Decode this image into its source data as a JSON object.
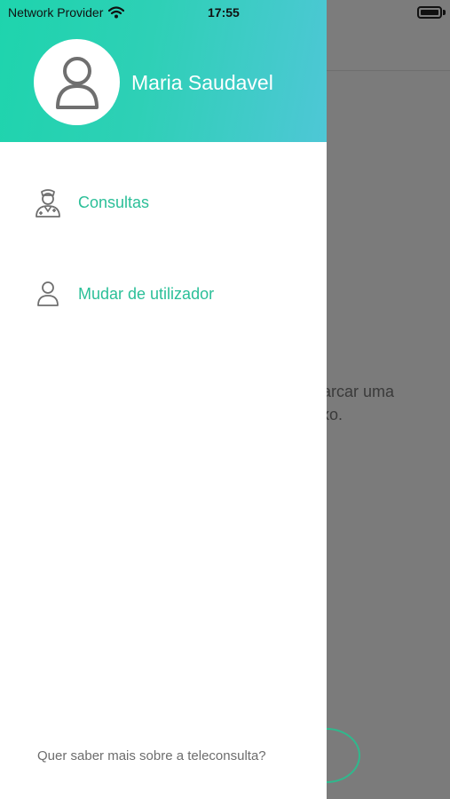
{
  "status_bar": {
    "carrier": "Network Provider",
    "time": "17:55",
    "icons": [
      "wifi-icon",
      "battery-icon"
    ]
  },
  "drawer": {
    "user_name": "Maria Saudavel",
    "avatar_icon": "user-icon",
    "items": [
      {
        "label": "Consultas",
        "icon": "doctor-icon"
      },
      {
        "label": "Mudar de utilizador",
        "icon": "user-icon"
      }
    ],
    "footer_link": "Quer saber mais sobre a teleconsulta?"
  },
  "background": {
    "text_line1": "marcar uma",
    "text_line2": "aixo."
  },
  "colors": {
    "accent": "#2bbf98",
    "header_gradient_start": "#1ed4ad",
    "header_gradient_end": "#4ec7d6",
    "overlay": "#7b7b7b"
  }
}
